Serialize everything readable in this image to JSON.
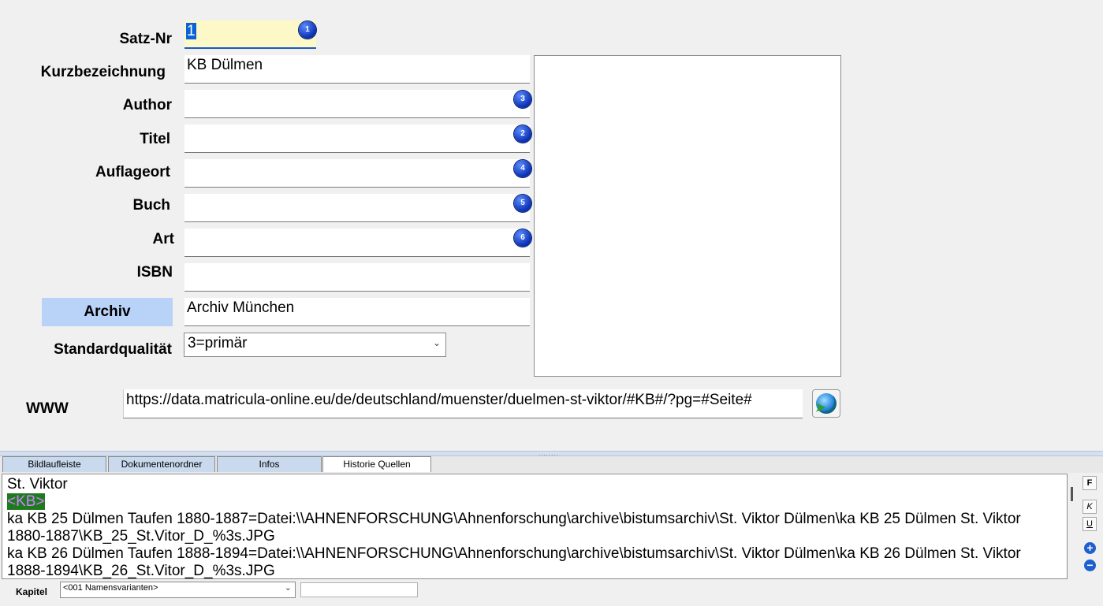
{
  "labels": {
    "satz_nr": "Satz-Nr",
    "kurzbezeichnung": "Kurzbezeichnung",
    "author": "Author",
    "titel": "Titel",
    "auflageort": "Auflageort",
    "buch": "Buch",
    "art": "Art",
    "isbn": "ISBN",
    "archiv": "Archiv",
    "standardqualitaet": "Standardqualität",
    "www": "WWW"
  },
  "values": {
    "satz_nr": "1",
    "kurzbezeichnung": "KB Dülmen",
    "author": "",
    "titel": "",
    "auflageort": "",
    "buch": "",
    "art": "",
    "isbn": "",
    "archiv": "Archiv München",
    "standardqualitaet": "3=primär",
    "www": "https://data.matricula-online.eu/de/deutschland/muenster/duelmen-st-viktor/#KB#/?pg=#Seite#"
  },
  "badges": {
    "satz_nr": "1",
    "author": "3",
    "titel": "2",
    "auflageort": "4",
    "buch": "5",
    "art": "6"
  },
  "tabs": [
    "Bildlaufleiste",
    "Dokumentenordner",
    "Infos",
    "Historie Quellen"
  ],
  "notes": {
    "line1": "St. Viktor",
    "tag": "<KB>",
    "line3": "ka KB 25 Dülmen Taufen 1880-1887=Datei:\\\\AHNENFORSCHUNG\\Ahnenforschung\\archive\\bistumsarchiv\\St. Viktor Dülmen\\ka KB 25 Dülmen St. Viktor",
    "line4": "1880-1887\\KB_25_St.Vitor_D_%3s.JPG",
    "line5": "ka KB 26 Dülmen Taufen 1888-1894=Datei:\\\\AHNENFORSCHUNG\\Ahnenforschung\\archive\\bistumsarchiv\\St. Viktor Dülmen\\ka KB 26 Dülmen St. Viktor",
    "line6": "1888-1894\\KB_26_St.Vitor_D_%3s.JPG"
  },
  "format_buttons": {
    "bold": "F",
    "italic": "K",
    "underline": "U"
  },
  "kapitel": {
    "label": "Kapitel",
    "selected": "<001 Namensvarianten>",
    "extra": ""
  },
  "colors": {
    "badge": "#0a2fb0",
    "archiv_label_bg": "#b8d2f8",
    "tag_bg": "#1f7a1f",
    "tag_fg": "#d080ff",
    "satz_bg": "#fcf8c8"
  }
}
